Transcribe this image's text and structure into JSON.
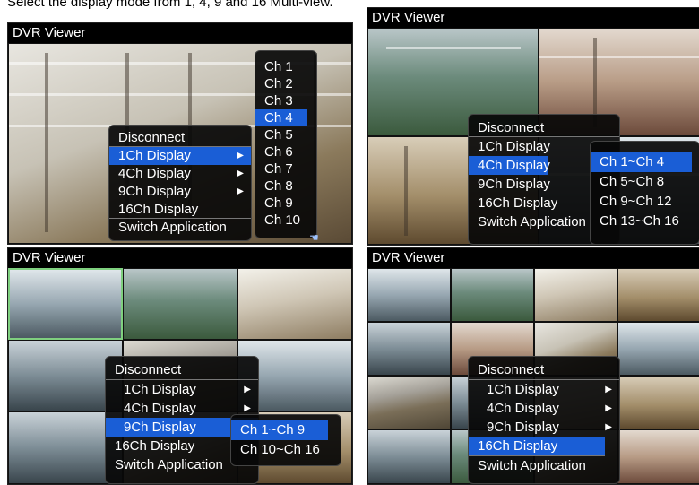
{
  "caption": "Select the display mode from 1, 4, 9 and 16 Multi-view.",
  "panels": [
    {
      "title": "DVR Viewer",
      "menu": {
        "items": [
          "Disconnect",
          "1Ch Display",
          "4Ch Display",
          "9Ch Display",
          "16Ch Display",
          "Switch Application"
        ],
        "highlighted": "1Ch Display"
      },
      "submenu": {
        "items": [
          "Ch 1",
          "Ch 2",
          "Ch 3",
          "Ch 4",
          "Ch 5",
          "Ch 6",
          "Ch 7",
          "Ch 8",
          "Ch 9",
          "Ch 10"
        ],
        "highlighted": "Ch 4"
      }
    },
    {
      "title": "DVR Viewer",
      "menu": {
        "items": [
          "Disconnect",
          "1Ch Display",
          "4Ch Display",
          "9Ch Display",
          "16Ch Display",
          "Switch Application"
        ],
        "highlighted": "4Ch Display"
      },
      "submenu": {
        "items": [
          "Ch 1~Ch 4",
          "Ch 5~Ch 8",
          "Ch 9~Ch 12",
          "Ch 13~Ch 16"
        ],
        "highlighted": "Ch 1~Ch 4"
      }
    },
    {
      "title": "DVR Viewer",
      "menu": {
        "items": [
          "Disconnect",
          "1Ch Display",
          "4Ch Display",
          "9Ch Display",
          "16Ch Display",
          "Switch Application"
        ],
        "highlighted": "9Ch Display"
      },
      "submenu": {
        "items": [
          "Ch 1~Ch 9",
          "Ch 10~Ch 16"
        ],
        "highlighted": "Ch 1~Ch 9"
      }
    },
    {
      "title": "DVR Viewer",
      "menu": {
        "items": [
          "Disconnect",
          "1Ch Display",
          "4Ch Display",
          "9Ch Display",
          "16Ch Display",
          "Switch Application"
        ],
        "highlighted": "16Ch Display"
      }
    }
  ],
  "colors": {
    "highlight": "#1a5ed6",
    "menu_bg": "#080808",
    "title_bg": "#000000",
    "selected_cell_border": "#7fd07f"
  },
  "icons": {
    "submenu_arrow": "chevron-right-icon",
    "cursor": "hand-pointer-icon"
  }
}
